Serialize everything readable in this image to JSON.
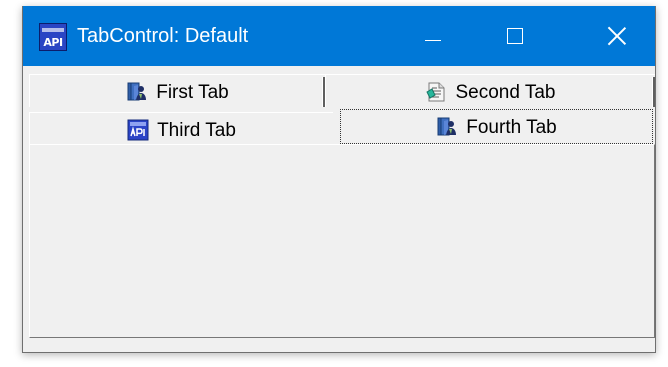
{
  "window": {
    "title": "TabControl: Default",
    "icon": "app-api-icon",
    "icon_text": "API",
    "controls": {
      "minimize": "minimize-icon",
      "maximize": "maximize-icon",
      "close": "close-icon"
    }
  },
  "tabs": [
    {
      "label": "First Tab",
      "icon": "book-person-icon",
      "selected": false
    },
    {
      "label": "Second Tab",
      "icon": "document-icon",
      "selected": false
    },
    {
      "label": "Third Tab",
      "icon": "api-icon",
      "selected": false
    },
    {
      "label": "Fourth Tab",
      "icon": "book-person-icon",
      "selected": true
    }
  ],
  "colors": {
    "titlebar": "#0078d7",
    "window_background": "#f0f0f0",
    "text": "#000000"
  }
}
